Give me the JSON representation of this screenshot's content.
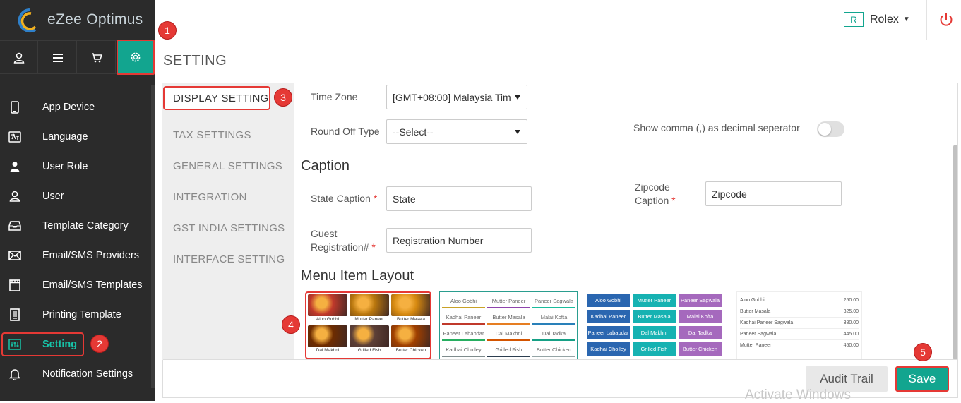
{
  "app": {
    "name": "eZee Optimus"
  },
  "header": {
    "badge": "R",
    "user": "Rolex"
  },
  "page": {
    "title": "SETTING"
  },
  "sidebar": {
    "items": [
      {
        "label": "App Device",
        "icon": "tablet-icon"
      },
      {
        "label": "Language",
        "icon": "language-icon"
      },
      {
        "label": "User Role",
        "icon": "user-role-icon"
      },
      {
        "label": "User",
        "icon": "user-icon"
      },
      {
        "label": "Template Category",
        "icon": "inbox-icon"
      },
      {
        "label": "Email/SMS Providers",
        "icon": "envelope-icon"
      },
      {
        "label": "Email/SMS Templates",
        "icon": "film-icon"
      },
      {
        "label": "Printing Template",
        "icon": "receipt-icon"
      },
      {
        "label": "Setting",
        "icon": "sliders-icon",
        "active": true
      },
      {
        "label": "Notification Settings",
        "icon": "bell-icon"
      }
    ]
  },
  "tabs": [
    {
      "label": "DISPLAY SETTING",
      "active": true
    },
    {
      "label": "TAX SETTINGS"
    },
    {
      "label": "GENERAL SETTINGS"
    },
    {
      "label": "INTEGRATION"
    },
    {
      "label": "GST INDIA SETTINGS"
    },
    {
      "label": "INTERFACE SETTING"
    }
  ],
  "form": {
    "timezone_label": "Time Zone",
    "timezone_value": "[GMT+08:00] Malaysia Tim",
    "roundoff_label": "Round Off Type",
    "roundoff_value": "--Select--",
    "comma_label": "Show comma (,) as decimal seperator",
    "comma_enabled": false
  },
  "caption": {
    "title": "Caption",
    "state_label": "State Caption",
    "state_value": "State",
    "zipcode_label_1": "Zipcode",
    "zipcode_label_2": "Caption",
    "zipcode_value": "Zipcode",
    "guest_label_1": "Guest",
    "guest_label_2": "Registration#",
    "guest_value": "Registration Number",
    "required_mark": "*"
  },
  "menu_layout": {
    "title": "Menu Item Layout",
    "layout1": [
      "Aloo Gobhi",
      "Mutter Paneer",
      "Butter Masala",
      "Dal Makhni",
      "Grilled Fish",
      "Butter Chicken"
    ],
    "layout2": [
      "Aloo Gobhi",
      "Mutter Paneer",
      "Paneer Sagwala",
      "Kadhai Paneer",
      "Butter Masala",
      "Malai Kofta",
      "Paneer Lababdar",
      "Dal Makhni",
      "Dal Tadka",
      "Kadhai Cholley",
      "Grilled Fish",
      "Butter Chicken"
    ],
    "layout3": [
      "Aloo Gobhi",
      "Mutter Paneer",
      "Paneer Sagwala",
      "Kadhai Paneer",
      "Butter Masala",
      "Malai Kofta",
      "Paneer Lababdar",
      "Dal Makhni",
      "Dal Tadka",
      "Kadhai Cholley",
      "Grilled Fish",
      "Butter Chicken"
    ],
    "layout4": [
      {
        "name": "Aloo Gobhi",
        "price": "250.00"
      },
      {
        "name": "Butter Masala",
        "price": "325.00"
      },
      {
        "name": "Kadhai Paneer Sagwala",
        "price": "380.00"
      },
      {
        "name": "Paneer Sagwala",
        "price": "445.00"
      },
      {
        "name": "Mutter Paneer",
        "price": "450.00"
      }
    ]
  },
  "footer": {
    "audit_label": "Audit Trail",
    "save_label": "Save"
  },
  "watermark": "Activate Windows",
  "callouts": [
    "1",
    "2",
    "3",
    "4",
    "5"
  ],
  "colors": {
    "accent": "#12a58f",
    "highlight": "#e53935",
    "sidebar_bg": "#2b2b2b"
  }
}
